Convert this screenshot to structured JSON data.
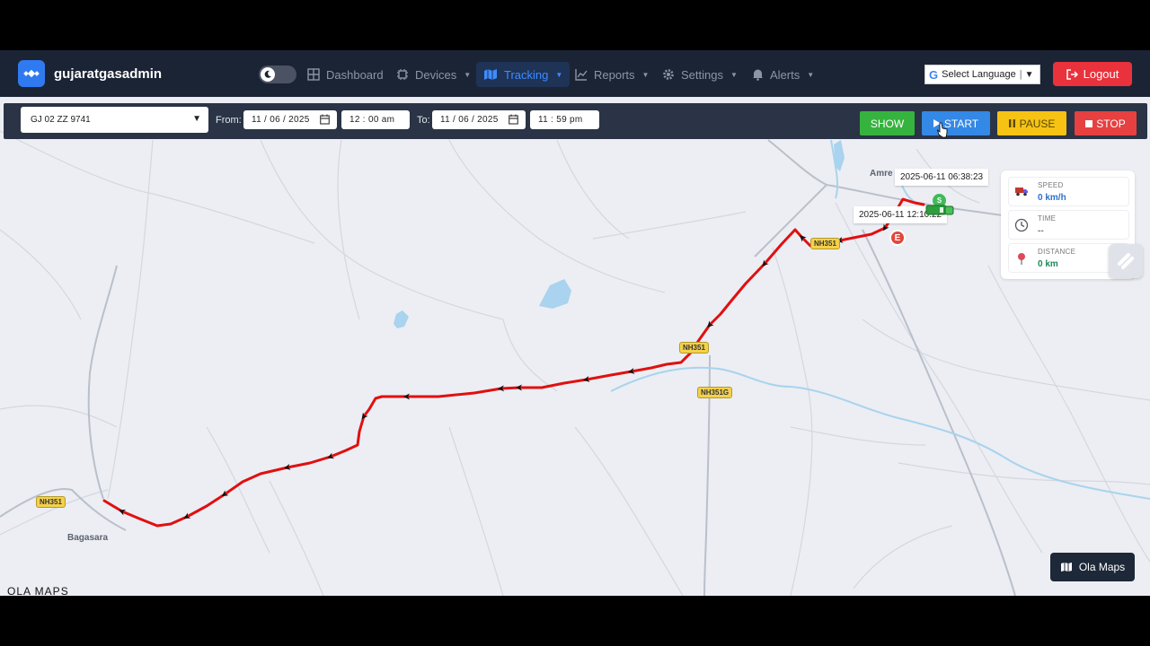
{
  "navbar": {
    "brand": "gujaratgasadmin",
    "items": [
      {
        "label": "Dashboard",
        "dropdown": false,
        "active": false
      },
      {
        "label": "Devices",
        "dropdown": true,
        "active": false
      },
      {
        "label": "Tracking",
        "dropdown": true,
        "active": true
      },
      {
        "label": "Reports",
        "dropdown": true,
        "active": false
      },
      {
        "label": "Settings",
        "dropdown": true,
        "active": false
      },
      {
        "label": "Alerts",
        "dropdown": true,
        "active": false
      }
    ],
    "language": "Select Language",
    "logout": "Logout"
  },
  "controls": {
    "vehicle": "GJ 02 ZZ 9741",
    "from_label": "From:",
    "from_date": "11 / 06 / 2025",
    "from_time": "12 : 00   am",
    "to_label": "To:",
    "to_date": "11 / 06 / 2025",
    "to_time": "11 : 59   pm",
    "show": "SHOW",
    "start": "START",
    "pause": "PAUSE",
    "stop": "STOP"
  },
  "map": {
    "towns": [
      "Amre",
      "Bagasara"
    ],
    "highways": [
      "NH351",
      "NH351",
      "NH351G",
      "NH351"
    ],
    "tooltips": [
      "2025-06-11 06:38:23",
      "2025-06-11 12:10:22"
    ],
    "markers": {
      "start": "S",
      "end": "E"
    },
    "attribution": "OLA MAPS",
    "maps_button": "Ola Maps"
  },
  "stats": [
    {
      "label": "SPEED",
      "value": "0 km/h",
      "color": "#2f6fd0"
    },
    {
      "label": "TIME",
      "value": "--",
      "color": "#777777"
    },
    {
      "label": "DISTANCE",
      "value": "0 km",
      "color": "#1a8a5e"
    }
  ],
  "colors": {
    "route": "#e01010",
    "accent": "#3d8cff"
  }
}
